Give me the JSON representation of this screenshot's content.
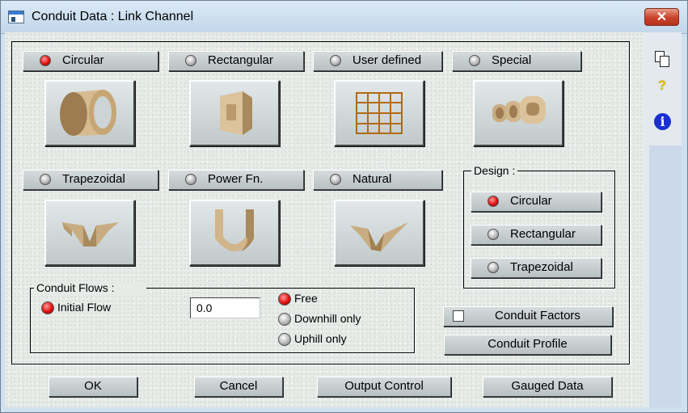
{
  "window": {
    "title": "Conduit Data : Link Channel",
    "close_glyph": "✕"
  },
  "side_icons": {
    "copy": "copy-icon",
    "help": "?",
    "info": "i"
  },
  "shapes": [
    {
      "label": "Circular",
      "selected": true
    },
    {
      "label": "Rectangular",
      "selected": false
    },
    {
      "label": "User defined",
      "selected": false
    },
    {
      "label": "Special",
      "selected": false
    },
    {
      "label": "Trapezoidal",
      "selected": false
    },
    {
      "label": "Power Fn.",
      "selected": false
    },
    {
      "label": "Natural",
      "selected": false
    }
  ],
  "design": {
    "title": "Design :",
    "options": [
      {
        "label": "Circular",
        "selected": true
      },
      {
        "label": "Rectangular",
        "selected": false
      },
      {
        "label": "Trapezoidal",
        "selected": false
      }
    ]
  },
  "flows": {
    "title": "Conduit Flows :",
    "initial_flow_label": "Initial Flow",
    "initial_flow_value": "0.0",
    "options": [
      {
        "label": "Free",
        "selected": true
      },
      {
        "label": "Downhill only",
        "selected": false
      },
      {
        "label": "Uphill only",
        "selected": false
      }
    ]
  },
  "buttons": {
    "conduit_factors": "Conduit Factors",
    "conduit_profile": "Conduit Profile",
    "ok": "OK",
    "cancel": "Cancel",
    "output_control": "Output Control",
    "gauged_data": "Gauged Data"
  },
  "colors": {
    "selected_led": "#e01010",
    "title_bar": "#cfe0ee",
    "close_button": "#c7432a"
  }
}
